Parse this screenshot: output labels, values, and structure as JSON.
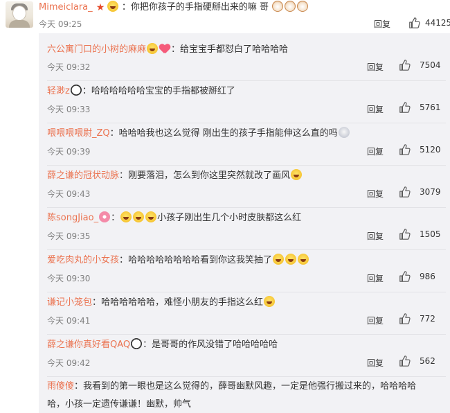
{
  "top_comment": {
    "name": "Mimeiclara_",
    "text": "：你把你孩子的手指硬掰出来的嘛 哥",
    "time": "今天 09:25",
    "reply": "回复",
    "likes": "44125"
  },
  "replies": [
    {
      "name": "六公寓门口的小树的麻麻",
      "text": "：给宝宝手都怼白了哈哈哈哈",
      "time": "今天 09:32",
      "reply": "回复",
      "likes": "7504"
    },
    {
      "name": "轻渺z",
      "text": "：哈哈哈哈哈哈宝宝的手指都被掰红了",
      "time": "今天 09:33",
      "reply": "回复",
      "likes": "5761"
    },
    {
      "name": "喂喂喂喂尉_ZQ",
      "text": "：哈哈哈我也这么觉得 刚出生的孩子手指能伸这么直的吗",
      "time": "今天 09:39",
      "reply": "回复",
      "likes": "5120"
    },
    {
      "name": "薛之谦的冠状动脉",
      "text": "：刚要落泪，怎么到你这里突然就改了画风",
      "time": "今天 09:43",
      "reply": "回复",
      "likes": "3079"
    },
    {
      "name": "陈songJiao_",
      "text": "小孩子刚出生几个小时皮肤都这么红",
      "time": "今天 09:35",
      "reply": "回复",
      "likes": "1505"
    },
    {
      "name": "爱吃肉丸的小女孩",
      "text": "：哈哈哈哈哈哈哈哈看到你这我笑抽了",
      "time": "今天 09:30",
      "reply": "回复",
      "likes": "986"
    },
    {
      "name": "谦记小笼包",
      "text": "：哈哈哈哈哈哈，难怪小朋友的手指这么红",
      "time": "今天 09:41",
      "reply": "回复",
      "likes": "772"
    },
    {
      "name": "薛之谦你真好看QAQ",
      "text": "：是哥哥的作风没错了哈哈哈哈哈",
      "time": "今天 09:42",
      "reply": "回复",
      "likes": "562"
    },
    {
      "name": "雨傻傻",
      "text": "：我看到的第一眼也是这么觉得的，薛哥幽默风趣，一定是他强行搬过来的，哈哈哈哈",
      "text2": "哈，小孩一定遗传谦谦！幽默，帅气"
    }
  ],
  "icons": {
    "like": "thumbs-up-icon",
    "accent_name_color": "#eb7350"
  }
}
